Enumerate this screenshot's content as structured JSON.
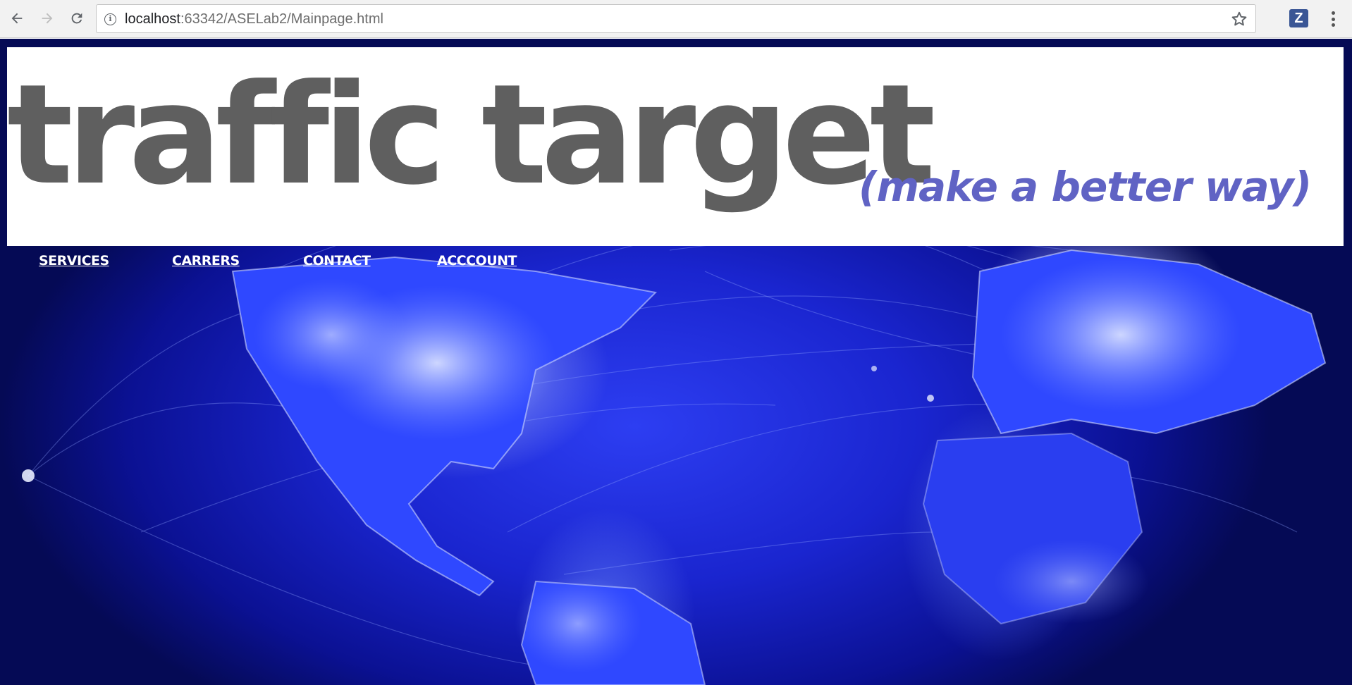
{
  "browser": {
    "url_host": "localhost",
    "url_rest": ":63342/ASELab2/Mainpage.html",
    "info_icon": "info-icon",
    "extension_label": "Z",
    "icons": [
      "back-arrow-icon",
      "forward-arrow-icon",
      "reload-icon",
      "star-icon",
      "kebab-menu-icon"
    ]
  },
  "header": {
    "title": "traffic target",
    "tagline": "(make a better way)"
  },
  "nav": {
    "services": "SERVICES",
    "carrers": "CARRERS",
    "contact": "CONTACT",
    "account": "ACCCOUNT"
  },
  "colors": {
    "title": "#5f5f5f",
    "tagline": "#6063c4",
    "background_blue": "#1a25cf",
    "nav_link": "#ffffff"
  }
}
